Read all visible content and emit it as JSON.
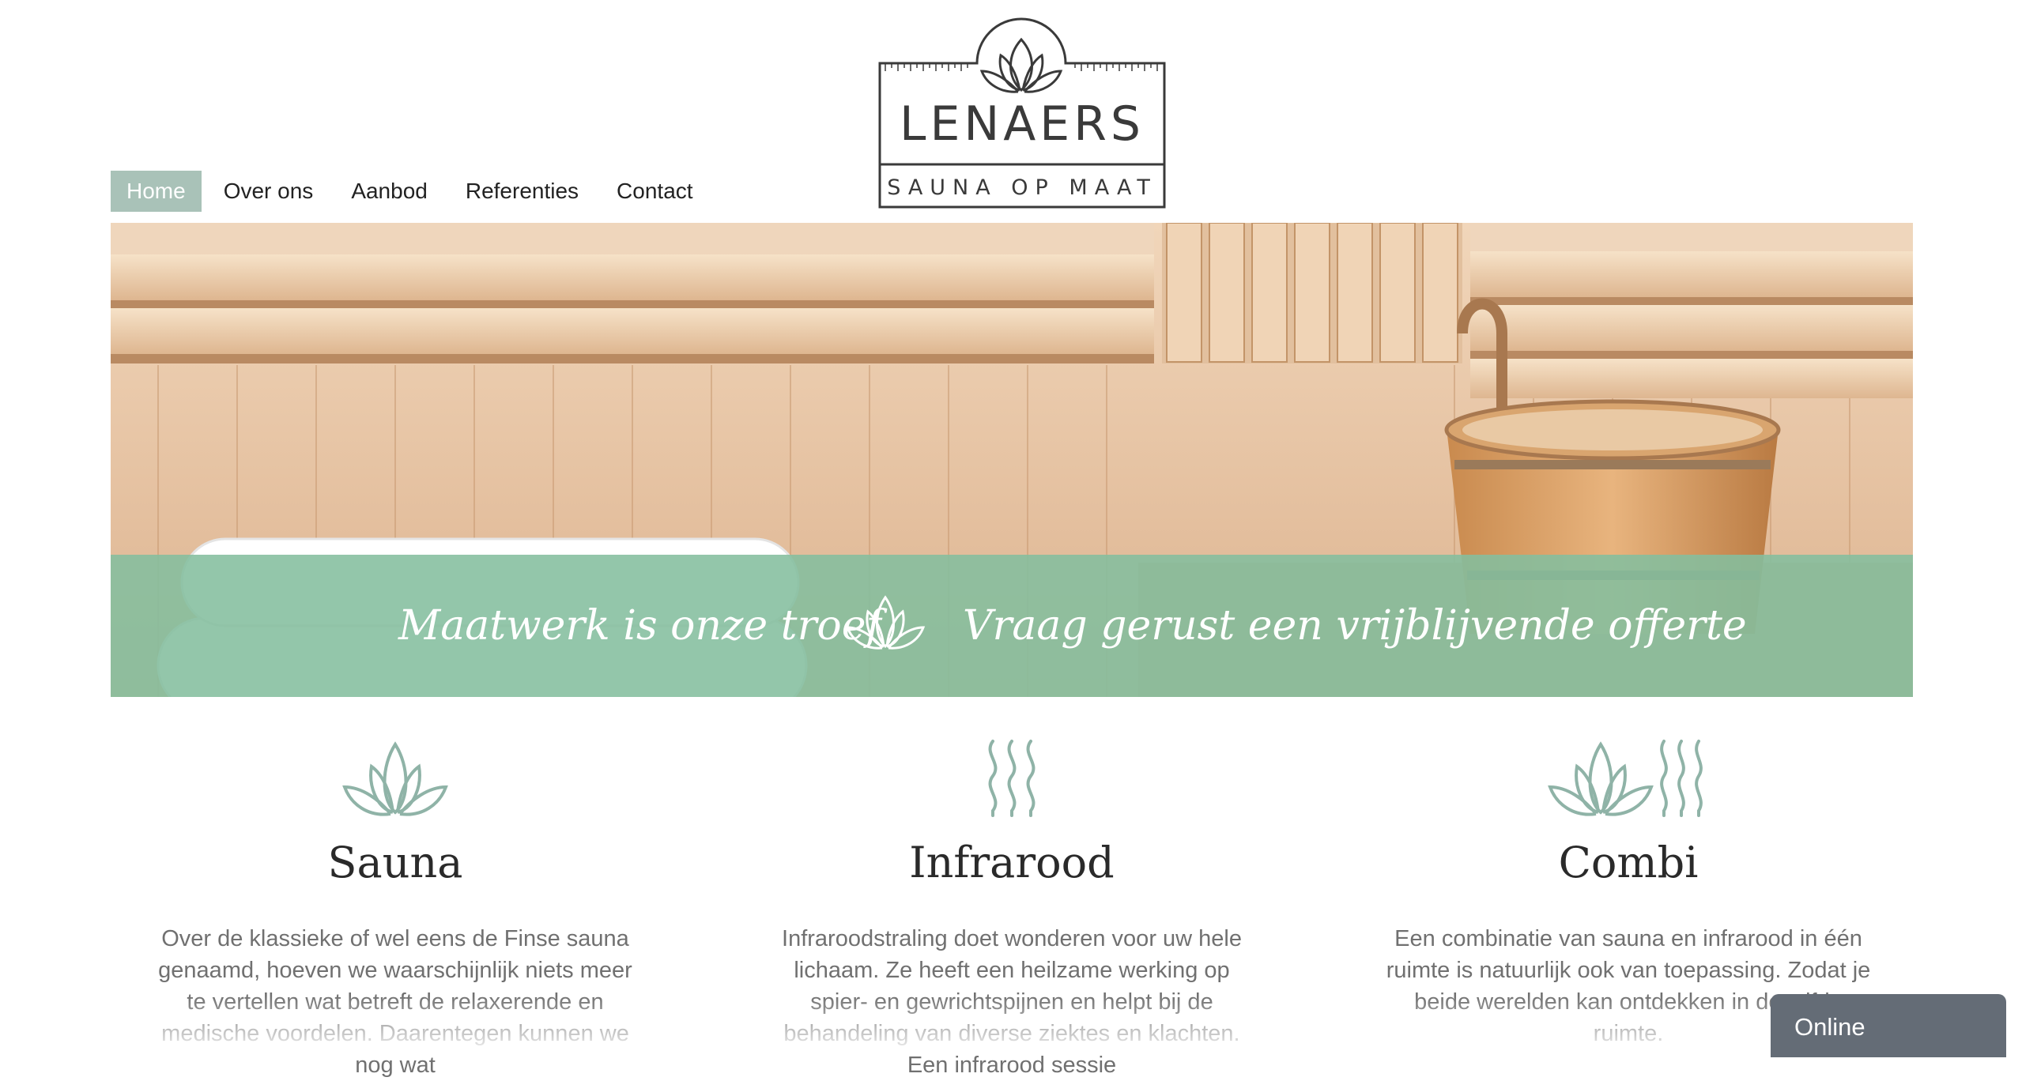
{
  "logo": {
    "name": "LENAERS",
    "tagline": "SAUNA OP MAAT"
  },
  "nav": {
    "items": [
      "Home",
      "Over ons",
      "Aanbod",
      "Referenties",
      "Contact"
    ],
    "active": "Home"
  },
  "hero": {
    "left_text": "Maatwerk is onze troef",
    "right_text": "Vraag gerust een vrijblijvende offerte",
    "banner_color": "#84be9e"
  },
  "features": [
    {
      "icon": "lotus-icon",
      "title": "Sauna",
      "body": "Over de klassieke of wel eens de Finse sauna genaamd, hoeven we waarschijnlijk niets meer te vertellen wat betreft de relaxerende en medische voordelen. Daarentegen kunnen we nog wat"
    },
    {
      "icon": "heat-waves-icon",
      "title": "Infrarood",
      "body": "Infraroodstraling doet wonderen voor uw hele lichaam. Ze heeft een heilzame werking op spier- en gewrichtspijnen en helpt bij de behandeling van diverse ziektes en klachten. Een infrarood sessie"
    },
    {
      "icon": "lotus-heat-waves-icon",
      "title": "Combi",
      "body": "Een combinatie van sauna en infrarood in één ruimte is natuurlijk ook van toepassing. Zodat je beide werelden kan ontdekken in dezelfde ruimte."
    }
  ],
  "chat": {
    "label": "Online"
  },
  "colors": {
    "icon": "#8fb3a7",
    "nav_active": "#a9c2b8",
    "chat": "#646c76"
  }
}
